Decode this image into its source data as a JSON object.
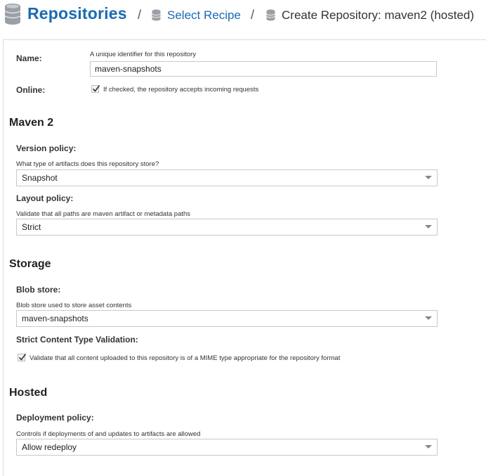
{
  "breadcrumb": {
    "root": "Repositories",
    "separator": "/",
    "recipe_link": "Select Recipe",
    "current": "Create Repository: maven2 (hosted)"
  },
  "form": {
    "name": {
      "label": "Name:",
      "help": "A unique identifier for this repository",
      "value": "maven-snapshots"
    },
    "online": {
      "label": "Online:",
      "checked": true,
      "help": "If checked, the repository accepts incoming requests"
    }
  },
  "maven2": {
    "title": "Maven 2",
    "version_policy": {
      "label": "Version policy:",
      "help": "What type of artifacts does this repository store?",
      "value": "Snapshot"
    },
    "layout_policy": {
      "label": "Layout policy:",
      "help": "Validate that all paths are maven artifact or metadata paths",
      "value": "Strict"
    }
  },
  "storage": {
    "title": "Storage",
    "blob_store": {
      "label": "Blob store:",
      "help": "Blob store used to store asset contents",
      "value": "maven-snapshots"
    },
    "strict_validation": {
      "label": "Strict Content Type Validation:",
      "checked": true,
      "help": "Validate that all content uploaded to this repository is of a MIME type appropriate for the repository format"
    }
  },
  "hosted": {
    "title": "Hosted",
    "deployment_policy": {
      "label": "Deployment policy:",
      "help": "Controls if deployments of and updates to artifacts are allowed",
      "value": "Allow redeploy"
    }
  },
  "colors": {
    "link": "#1a6ab3",
    "border": "#c9c9c9"
  }
}
